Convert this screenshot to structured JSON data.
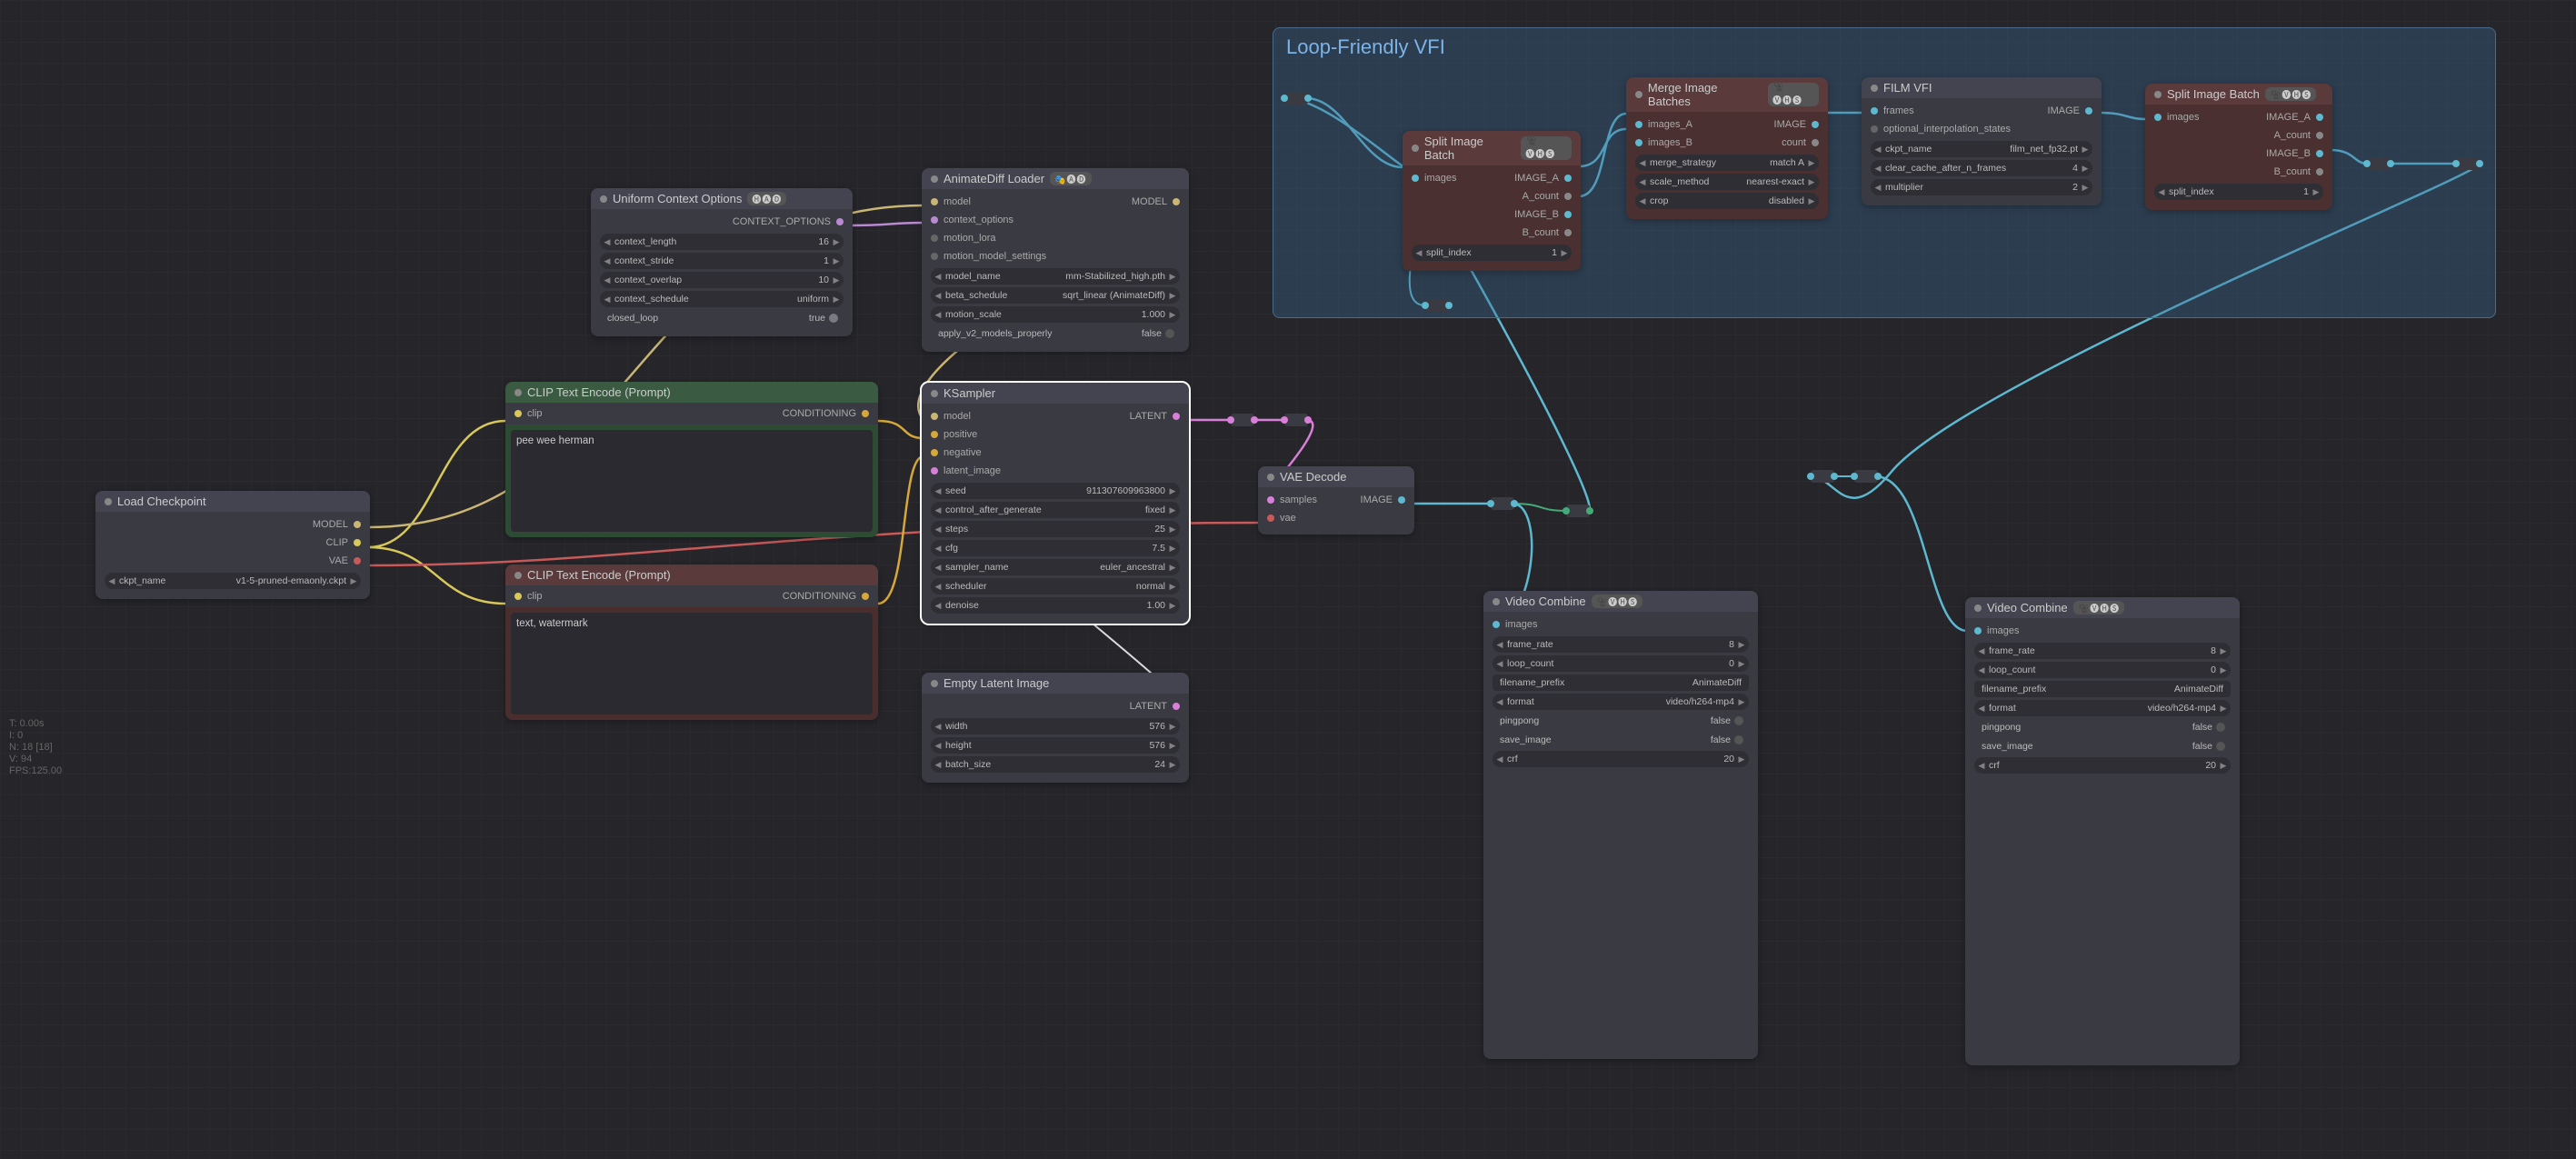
{
  "stats": {
    "line1": "T: 0.00s",
    "line2": "I: 0",
    "line3": "N: 18 [18]",
    "line4": "V: 94",
    "line5": "FPS:125.00"
  },
  "group": {
    "title": "Loop-Friendly VFI"
  },
  "load_ckpt": {
    "title": "Load Checkpoint",
    "out1": "MODEL",
    "out2": "CLIP",
    "out3": "VAE",
    "w_ckpt": {
      "label": "ckpt_name",
      "value": "v1-5-pruned-emaonly.ckpt"
    }
  },
  "uctx": {
    "title": "Uniform Context Options",
    "badge": "🅗🅐🅓",
    "out": "CONTEXT_OPTIONS",
    "w1": {
      "label": "context_length",
      "value": "16"
    },
    "w2": {
      "label": "context_stride",
      "value": "1"
    },
    "w3": {
      "label": "context_overlap",
      "value": "10"
    },
    "w4": {
      "label": "context_schedule",
      "value": "uniform"
    },
    "w5": {
      "label": "closed_loop",
      "value": "true"
    }
  },
  "adloader": {
    "title": "AnimateDiff Loader",
    "badge": "🎭🅐🅓",
    "in1": "model",
    "in2": "context_options",
    "in3": "motion_lora",
    "in4": "motion_model_settings",
    "out": "MODEL",
    "w1": {
      "label": "model_name",
      "value": "mm-Stabilized_high.pth"
    },
    "w2": {
      "label": "beta_schedule",
      "value": "sqrt_linear (AnimateDiff)"
    },
    "w3": {
      "label": "motion_scale",
      "value": "1.000"
    },
    "w4": {
      "label": "apply_v2_models_properly",
      "value": "false"
    }
  },
  "clip_pos": {
    "title": "CLIP Text Encode (Prompt)",
    "in": "clip",
    "out": "CONDITIONING",
    "text": "pee wee herman"
  },
  "clip_neg": {
    "title": "CLIP Text Encode (Prompt)",
    "in": "clip",
    "out": "CONDITIONING",
    "text": "text, watermark"
  },
  "ksampler": {
    "title": "KSampler",
    "in1": "model",
    "in2": "positive",
    "in3": "negative",
    "in4": "latent_image",
    "out": "LATENT",
    "w1": {
      "label": "seed",
      "value": "911307609963800"
    },
    "w2": {
      "label": "control_after_generate",
      "value": "fixed"
    },
    "w3": {
      "label": "steps",
      "value": "25"
    },
    "w4": {
      "label": "cfg",
      "value": "7.5"
    },
    "w5": {
      "label": "sampler_name",
      "value": "euler_ancestral"
    },
    "w6": {
      "label": "scheduler",
      "value": "normal"
    },
    "w7": {
      "label": "denoise",
      "value": "1.00"
    }
  },
  "latent": {
    "title": "Empty Latent Image",
    "out": "LATENT",
    "w1": {
      "label": "width",
      "value": "576"
    },
    "w2": {
      "label": "height",
      "value": "576"
    },
    "w3": {
      "label": "batch_size",
      "value": "24"
    }
  },
  "vaedec": {
    "title": "VAE Decode",
    "in1": "samples",
    "in2": "vae",
    "out": "IMAGE"
  },
  "split1": {
    "title": "Split Image Batch",
    "badge": "🎥🅥🅗🅢",
    "in": "images",
    "out1": "IMAGE_A",
    "out2": "A_count",
    "out3": "IMAGE_B",
    "out4": "B_count",
    "w": {
      "label": "split_index",
      "value": "1"
    }
  },
  "merge": {
    "title": "Merge Image Batches",
    "badge": "🎥🅥🅗🅢",
    "in1": "images_A",
    "in2": "images_B",
    "out1": "IMAGE",
    "out2": "count",
    "w1": {
      "label": "merge_strategy",
      "value": "match A"
    },
    "w2": {
      "label": "scale_method",
      "value": "nearest-exact"
    },
    "w3": {
      "label": "crop",
      "value": "disabled"
    }
  },
  "film": {
    "title": "FILM VFI",
    "in1": "frames",
    "in2": "optional_interpolation_states",
    "out": "IMAGE",
    "w1": {
      "label": "ckpt_name",
      "value": "film_net_fp32.pt"
    },
    "w2": {
      "label": "clear_cache_after_n_frames",
      "value": "4"
    },
    "w3": {
      "label": "multiplier",
      "value": "2"
    }
  },
  "split2": {
    "title": "Split Image Batch",
    "badge": "🎥🅥🅗🅢",
    "in": "images",
    "out1": "IMAGE_A",
    "out2": "A_count",
    "out3": "IMAGE_B",
    "out4": "B_count",
    "w": {
      "label": "split_index",
      "value": "1"
    }
  },
  "vc1": {
    "title": "Video Combine",
    "badge": "🎥🅥🅗🅢",
    "in": "images",
    "w1": {
      "label": "frame_rate",
      "value": "8"
    },
    "w2": {
      "label": "loop_count",
      "value": "0"
    },
    "w3": {
      "label": "filename_prefix",
      "value": "AnimateDiff"
    },
    "w4": {
      "label": "format",
      "value": "video/h264-mp4"
    },
    "w5": {
      "label": "pingpong",
      "value": "false"
    },
    "w6": {
      "label": "save_image",
      "value": "false"
    },
    "w7": {
      "label": "crf",
      "value": "20"
    }
  },
  "vc2": {
    "title": "Video Combine",
    "badge": "🎥🅥🅗🅢",
    "in": "images",
    "w1": {
      "label": "frame_rate",
      "value": "8"
    },
    "w2": {
      "label": "loop_count",
      "value": "0"
    },
    "w3": {
      "label": "filename_prefix",
      "value": "AnimateDiff"
    },
    "w4": {
      "label": "format",
      "value": "video/h264-mp4"
    },
    "w5": {
      "label": "pingpong",
      "value": "false"
    },
    "w6": {
      "label": "save_image",
      "value": "false"
    },
    "w7": {
      "label": "crf",
      "value": "20"
    }
  }
}
